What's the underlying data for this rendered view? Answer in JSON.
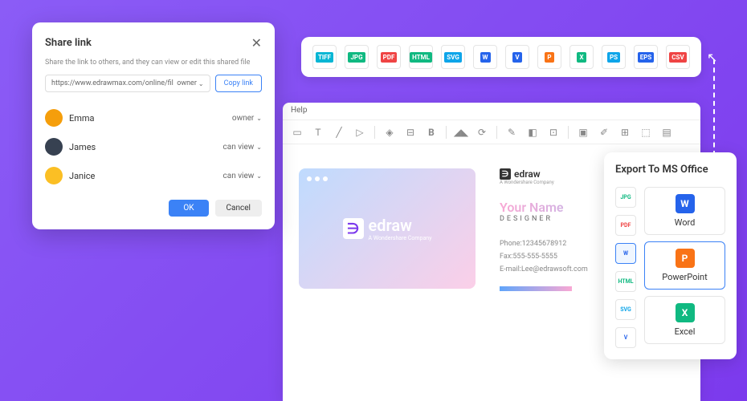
{
  "formatBar": [
    {
      "label": "TIFF",
      "color": "#06b6d4"
    },
    {
      "label": "JPG",
      "color": "#10b981"
    },
    {
      "label": "PDF",
      "color": "#ef4444"
    },
    {
      "label": "HTML",
      "color": "#10b981"
    },
    {
      "label": "SVG",
      "color": "#0ea5e9"
    },
    {
      "label": "W",
      "color": "#2563eb"
    },
    {
      "label": "V",
      "color": "#2563eb"
    },
    {
      "label": "P",
      "color": "#f97316"
    },
    {
      "label": "X",
      "color": "#10b981"
    },
    {
      "label": "PS",
      "color": "#0ea5e9"
    },
    {
      "label": "EPS",
      "color": "#2563eb"
    },
    {
      "label": "CSV",
      "color": "#ef4444"
    }
  ],
  "editor": {
    "menu": "Help",
    "card": {
      "brand": "edraw",
      "brandSub": "A Wondershare Company",
      "name": "Your Name",
      "role": "DESIGNER",
      "phone": "Phone:12345678912",
      "fax": "Fax:555-555-5555",
      "email": "E-mail:Lee@edrawsoft.com"
    }
  },
  "export": {
    "title": "Export To MS Office",
    "sideFormats": [
      {
        "label": "JPG",
        "color": "#10b981"
      },
      {
        "label": "PDF",
        "color": "#ef4444"
      },
      {
        "label": "W",
        "color": "#2563eb",
        "selected": true
      },
      {
        "label": "HTML",
        "color": "#10b981"
      },
      {
        "label": "SVG",
        "color": "#0ea5e9"
      },
      {
        "label": "V",
        "color": "#2563eb"
      }
    ],
    "options": [
      {
        "label": "Word",
        "icon": "W",
        "color": "#2563eb"
      },
      {
        "label": "PowerPoint",
        "icon": "P",
        "color": "#f97316",
        "selected": true
      },
      {
        "label": "Excel",
        "icon": "X",
        "color": "#10b981"
      }
    ]
  },
  "share": {
    "title": "Share link",
    "desc": "Share the link to others, and they can view or edit this shared file",
    "url": "https://www.edrawmax.com/online/fil",
    "urlRole": "owner",
    "copy": "Copy link",
    "users": [
      {
        "name": "Emma",
        "role": "owner",
        "color": "#f59e0b"
      },
      {
        "name": "James",
        "role": "can view",
        "color": "#374151"
      },
      {
        "name": "Janice",
        "role": "can view",
        "color": "#fbbf24"
      }
    ],
    "ok": "OK",
    "cancel": "Cancel"
  }
}
